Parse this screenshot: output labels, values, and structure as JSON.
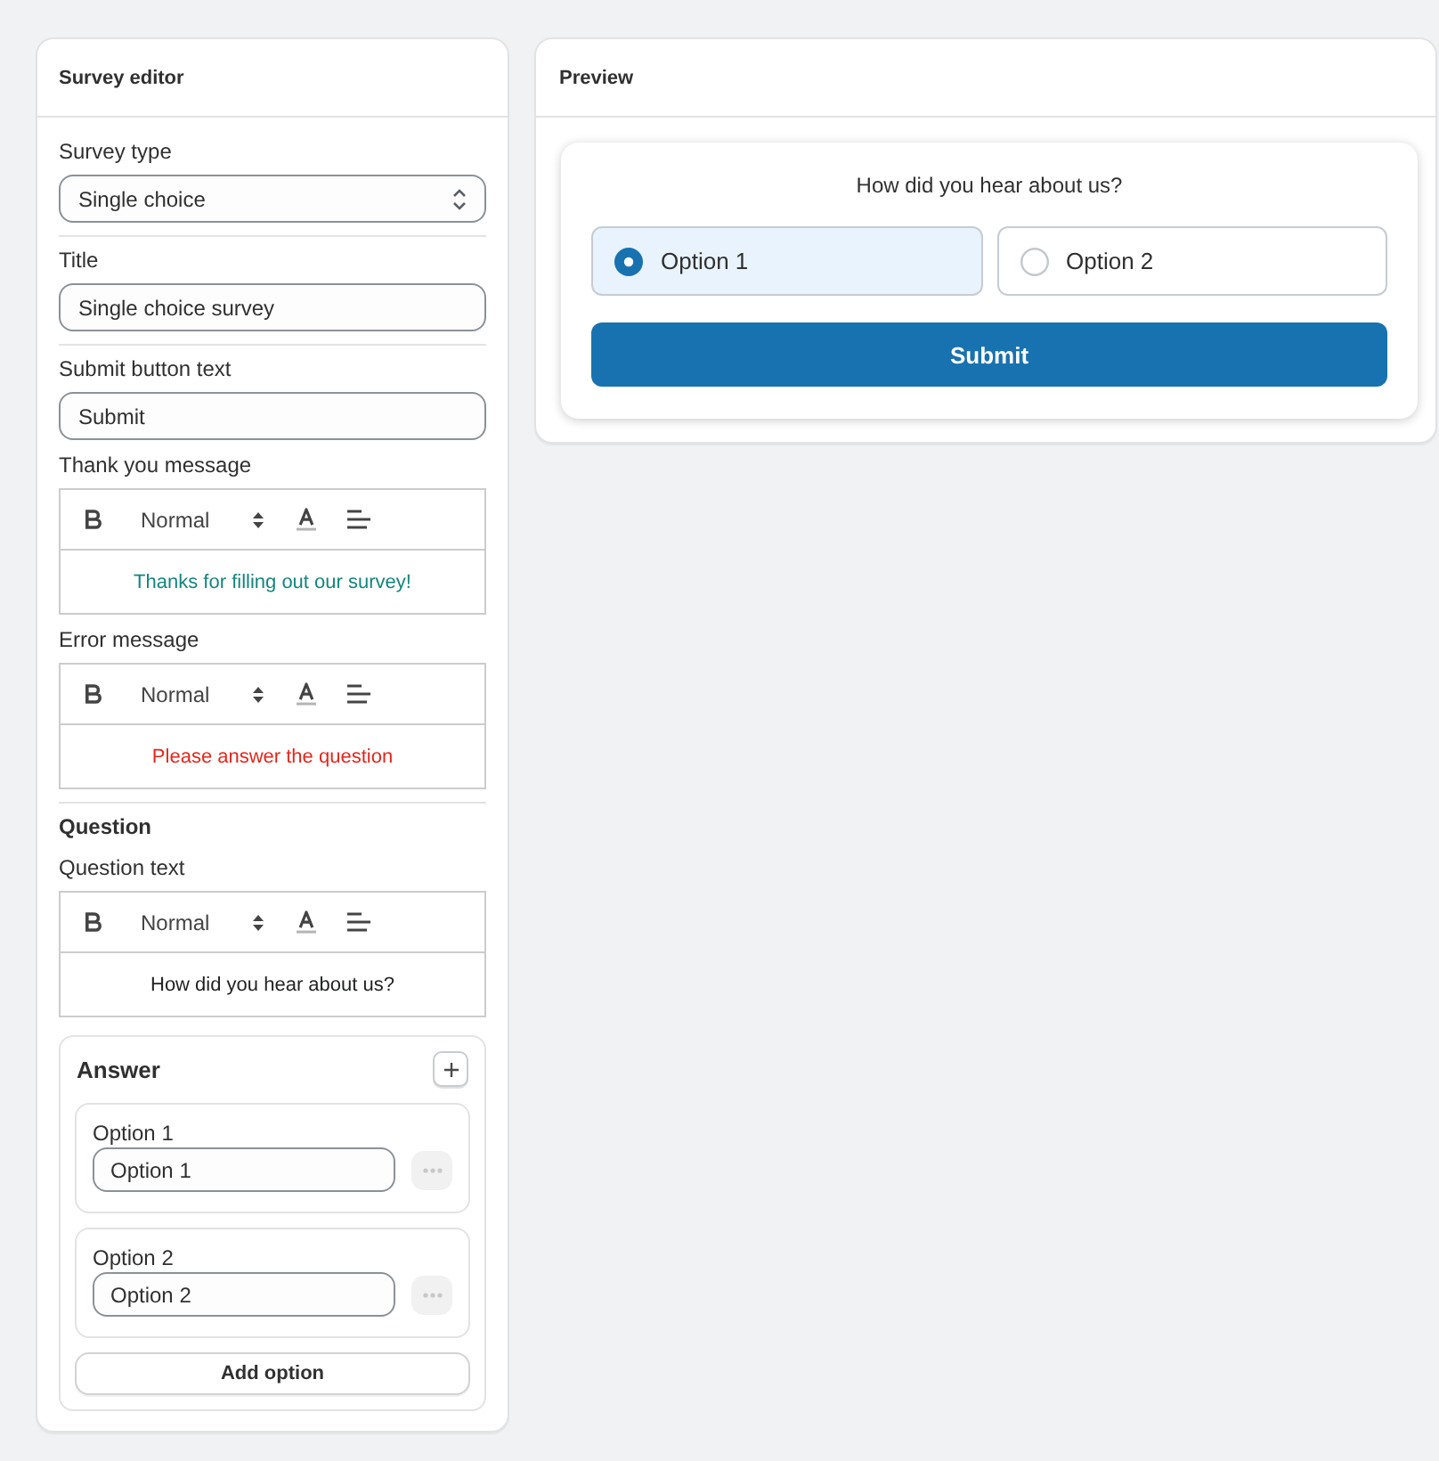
{
  "editor": {
    "title": "Survey editor",
    "groups": [
      {
        "fields": [
          {
            "kind": "select",
            "label": "Survey type",
            "value": "Single choice"
          }
        ]
      },
      {
        "fields": [
          {
            "kind": "text",
            "label": "Title",
            "value": "Single choice survey"
          }
        ]
      },
      {
        "fields": [
          {
            "kind": "text",
            "label": "Submit button text",
            "value": "Submit"
          },
          {
            "kind": "rich_text",
            "label": "Thank you message",
            "format": "Normal",
            "content": "Thanks for filling out our survey!",
            "color": "#12867c"
          },
          {
            "kind": "rich_text",
            "label": "Error message",
            "format": "Normal",
            "content": "Please answer the question",
            "color": "#e3261c"
          }
        ]
      },
      {
        "heading": "Question",
        "fields": [
          {
            "kind": "rich_text",
            "label": "Question text",
            "format": "Normal",
            "content": "How did you hear about us?",
            "color": "#202223"
          }
        ],
        "answer": {
          "title": "Answer",
          "options": [
            {
              "label": "Option 1",
              "value": "Option 1",
              "actions_disabled": true
            },
            {
              "label": "Option 2",
              "value": "Option 2",
              "actions_disabled": true
            }
          ],
          "add_button": "Add option"
        }
      }
    ]
  },
  "preview": {
    "title": "Preview",
    "question": "How did you hear about us?",
    "options": [
      {
        "label": "Option 1",
        "selected": true
      },
      {
        "label": "Option 2",
        "selected": false
      }
    ],
    "submit": "Submit"
  }
}
